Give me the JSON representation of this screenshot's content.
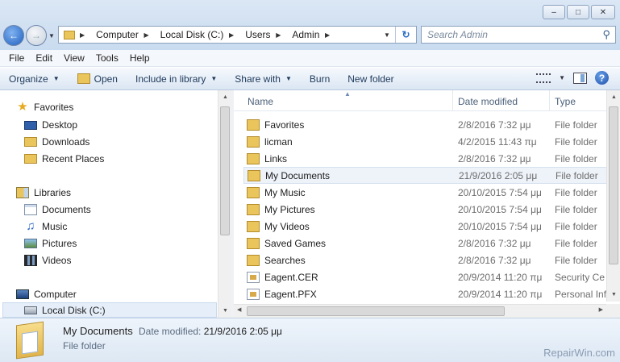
{
  "window": {
    "controls": [
      "minimize",
      "maximize",
      "close"
    ]
  },
  "address_bar": {
    "crumbs": [
      "Computer",
      "Local Disk (C:)",
      "Users",
      "Admin"
    ]
  },
  "search": {
    "placeholder": "Search Admin"
  },
  "menu": [
    "File",
    "Edit",
    "View",
    "Tools",
    "Help"
  ],
  "toolbar": {
    "organize": "Organize",
    "open": "Open",
    "include_in_library": "Include in library",
    "share_with": "Share with",
    "burn": "Burn",
    "new_folder": "New folder"
  },
  "nav": {
    "favorites": "Favorites",
    "desktop": "Desktop",
    "downloads": "Downloads",
    "recent_places": "Recent Places",
    "libraries": "Libraries",
    "documents": "Documents",
    "music": "Music",
    "pictures": "Pictures",
    "videos": "Videos",
    "computer": "Computer",
    "local_disk": "Local Disk (C:)"
  },
  "columns": {
    "name": "Name",
    "date_modified": "Date modified",
    "type": "Type"
  },
  "files": [
    {
      "name": "Favorites",
      "date": "2/8/2016 7:32 μμ",
      "type": "File folder",
      "kind": "folder"
    },
    {
      "name": "licman",
      "date": "4/2/2015 11:43 πμ",
      "type": "File folder",
      "kind": "folder"
    },
    {
      "name": "Links",
      "date": "2/8/2016 7:32 μμ",
      "type": "File folder",
      "kind": "folder"
    },
    {
      "name": "My Documents",
      "date": "21/9/2016 2:05 μμ",
      "type": "File folder",
      "kind": "folder"
    },
    {
      "name": "My Music",
      "date": "20/10/2015 7:54 μμ",
      "type": "File folder",
      "kind": "folder"
    },
    {
      "name": "My Pictures",
      "date": "20/10/2015 7:54 μμ",
      "type": "File folder",
      "kind": "folder"
    },
    {
      "name": "My Videos",
      "date": "20/10/2015 7:54 μμ",
      "type": "File folder",
      "kind": "folder"
    },
    {
      "name": "Saved Games",
      "date": "2/8/2016 7:32 μμ",
      "type": "File folder",
      "kind": "folder"
    },
    {
      "name": "Searches",
      "date": "2/8/2016 7:32 μμ",
      "type": "File folder",
      "kind": "folder"
    },
    {
      "name": "Eagent.CER",
      "date": "20/9/2014 11:20 πμ",
      "type": "Security Ce",
      "kind": "file"
    },
    {
      "name": "Eagent.PFX",
      "date": "20/9/2014 11:20 πμ",
      "type": "Personal Inf",
      "kind": "file"
    }
  ],
  "details": {
    "name": "My Documents",
    "date_label": "Date modified:",
    "date_value": "21/9/2016 2:05 μμ",
    "type": "File folder"
  },
  "watermark": "RepairWin.com"
}
